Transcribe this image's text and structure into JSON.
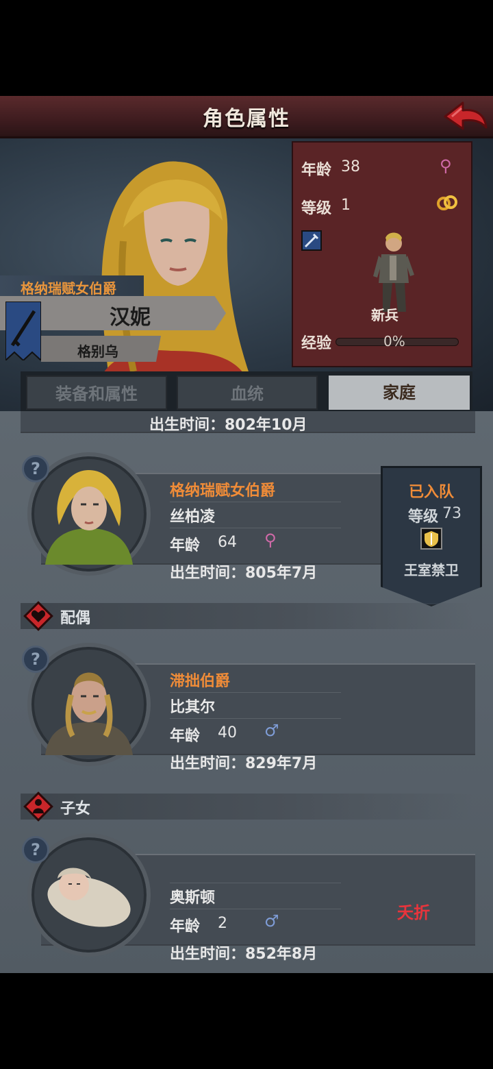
{
  "header": {
    "title": "角色属性",
    "back_icon": "back-arrow-icon"
  },
  "character": {
    "title": "格纳瑞赋女伯爵",
    "name": "汉妮",
    "house": "格别乌",
    "stats": {
      "age_label": "年龄",
      "age": "38",
      "level_label": "等级",
      "level": "1",
      "unit": "新兵",
      "exp_label": "经验",
      "exp_value": "0%"
    }
  },
  "tabs": [
    {
      "label": "装备和属性",
      "active": false
    },
    {
      "label": "血统",
      "active": false
    },
    {
      "label": "家庭",
      "active": true
    }
  ],
  "family": {
    "partial_birth": "出生时间：802年10月",
    "parent": {
      "title": "格纳瑞赋女伯爵",
      "name": "丝柏凌",
      "age_label": "年龄",
      "age": "64",
      "birth": "出生时间：805年7月",
      "party": {
        "status": "已入队",
        "level_label": "等级",
        "level": "73",
        "unit": "王室禁卫"
      }
    },
    "spouse_section": "配偶",
    "spouse": {
      "title": "滞拙伯爵",
      "name": "比其尔",
      "age_label": "年龄",
      "age": "40",
      "birth": "出生时间：829年7月"
    },
    "children_section": "子女",
    "child": {
      "name": "奥斯顿",
      "age_label": "年龄",
      "age": "2",
      "birth": "出生时间：852年8月",
      "status": "夭折"
    }
  },
  "colors": {
    "title_orange": "#f08c38",
    "dead_red": "#e8343c",
    "female_pink": "#d06aa8",
    "male_blue": "#7e9cd6"
  }
}
